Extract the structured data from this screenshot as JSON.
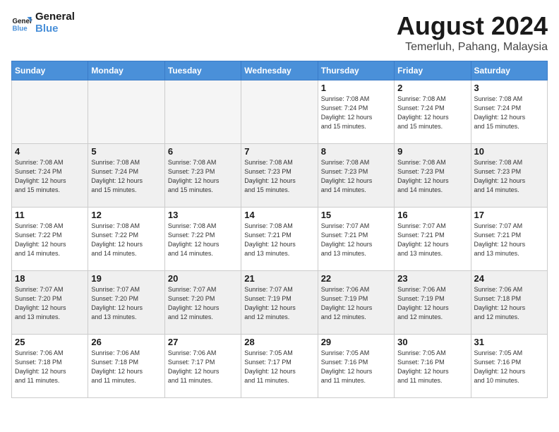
{
  "header": {
    "logo_general": "General",
    "logo_blue": "Blue",
    "month_year": "August 2024",
    "location": "Temerluh, Pahang, Malaysia"
  },
  "weekdays": [
    "Sunday",
    "Monday",
    "Tuesday",
    "Wednesday",
    "Thursday",
    "Friday",
    "Saturday"
  ],
  "weeks": [
    [
      {
        "day": "",
        "info": ""
      },
      {
        "day": "",
        "info": ""
      },
      {
        "day": "",
        "info": ""
      },
      {
        "day": "",
        "info": ""
      },
      {
        "day": "1",
        "info": "Sunrise: 7:08 AM\nSunset: 7:24 PM\nDaylight: 12 hours\nand 15 minutes."
      },
      {
        "day": "2",
        "info": "Sunrise: 7:08 AM\nSunset: 7:24 PM\nDaylight: 12 hours\nand 15 minutes."
      },
      {
        "day": "3",
        "info": "Sunrise: 7:08 AM\nSunset: 7:24 PM\nDaylight: 12 hours\nand 15 minutes."
      }
    ],
    [
      {
        "day": "4",
        "info": "Sunrise: 7:08 AM\nSunset: 7:24 PM\nDaylight: 12 hours\nand 15 minutes."
      },
      {
        "day": "5",
        "info": "Sunrise: 7:08 AM\nSunset: 7:24 PM\nDaylight: 12 hours\nand 15 minutes."
      },
      {
        "day": "6",
        "info": "Sunrise: 7:08 AM\nSunset: 7:23 PM\nDaylight: 12 hours\nand 15 minutes."
      },
      {
        "day": "7",
        "info": "Sunrise: 7:08 AM\nSunset: 7:23 PM\nDaylight: 12 hours\nand 15 minutes."
      },
      {
        "day": "8",
        "info": "Sunrise: 7:08 AM\nSunset: 7:23 PM\nDaylight: 12 hours\nand 14 minutes."
      },
      {
        "day": "9",
        "info": "Sunrise: 7:08 AM\nSunset: 7:23 PM\nDaylight: 12 hours\nand 14 minutes."
      },
      {
        "day": "10",
        "info": "Sunrise: 7:08 AM\nSunset: 7:23 PM\nDaylight: 12 hours\nand 14 minutes."
      }
    ],
    [
      {
        "day": "11",
        "info": "Sunrise: 7:08 AM\nSunset: 7:22 PM\nDaylight: 12 hours\nand 14 minutes."
      },
      {
        "day": "12",
        "info": "Sunrise: 7:08 AM\nSunset: 7:22 PM\nDaylight: 12 hours\nand 14 minutes."
      },
      {
        "day": "13",
        "info": "Sunrise: 7:08 AM\nSunset: 7:22 PM\nDaylight: 12 hours\nand 14 minutes."
      },
      {
        "day": "14",
        "info": "Sunrise: 7:08 AM\nSunset: 7:21 PM\nDaylight: 12 hours\nand 13 minutes."
      },
      {
        "day": "15",
        "info": "Sunrise: 7:07 AM\nSunset: 7:21 PM\nDaylight: 12 hours\nand 13 minutes."
      },
      {
        "day": "16",
        "info": "Sunrise: 7:07 AM\nSunset: 7:21 PM\nDaylight: 12 hours\nand 13 minutes."
      },
      {
        "day": "17",
        "info": "Sunrise: 7:07 AM\nSunset: 7:21 PM\nDaylight: 12 hours\nand 13 minutes."
      }
    ],
    [
      {
        "day": "18",
        "info": "Sunrise: 7:07 AM\nSunset: 7:20 PM\nDaylight: 12 hours\nand 13 minutes."
      },
      {
        "day": "19",
        "info": "Sunrise: 7:07 AM\nSunset: 7:20 PM\nDaylight: 12 hours\nand 13 minutes."
      },
      {
        "day": "20",
        "info": "Sunrise: 7:07 AM\nSunset: 7:20 PM\nDaylight: 12 hours\nand 12 minutes."
      },
      {
        "day": "21",
        "info": "Sunrise: 7:07 AM\nSunset: 7:19 PM\nDaylight: 12 hours\nand 12 minutes."
      },
      {
        "day": "22",
        "info": "Sunrise: 7:06 AM\nSunset: 7:19 PM\nDaylight: 12 hours\nand 12 minutes."
      },
      {
        "day": "23",
        "info": "Sunrise: 7:06 AM\nSunset: 7:19 PM\nDaylight: 12 hours\nand 12 minutes."
      },
      {
        "day": "24",
        "info": "Sunrise: 7:06 AM\nSunset: 7:18 PM\nDaylight: 12 hours\nand 12 minutes."
      }
    ],
    [
      {
        "day": "25",
        "info": "Sunrise: 7:06 AM\nSunset: 7:18 PM\nDaylight: 12 hours\nand 11 minutes."
      },
      {
        "day": "26",
        "info": "Sunrise: 7:06 AM\nSunset: 7:18 PM\nDaylight: 12 hours\nand 11 minutes."
      },
      {
        "day": "27",
        "info": "Sunrise: 7:06 AM\nSunset: 7:17 PM\nDaylight: 12 hours\nand 11 minutes."
      },
      {
        "day": "28",
        "info": "Sunrise: 7:05 AM\nSunset: 7:17 PM\nDaylight: 12 hours\nand 11 minutes."
      },
      {
        "day": "29",
        "info": "Sunrise: 7:05 AM\nSunset: 7:16 PM\nDaylight: 12 hours\nand 11 minutes."
      },
      {
        "day": "30",
        "info": "Sunrise: 7:05 AM\nSunset: 7:16 PM\nDaylight: 12 hours\nand 11 minutes."
      },
      {
        "day": "31",
        "info": "Sunrise: 7:05 AM\nSunset: 7:16 PM\nDaylight: 12 hours\nand 10 minutes."
      }
    ]
  ]
}
